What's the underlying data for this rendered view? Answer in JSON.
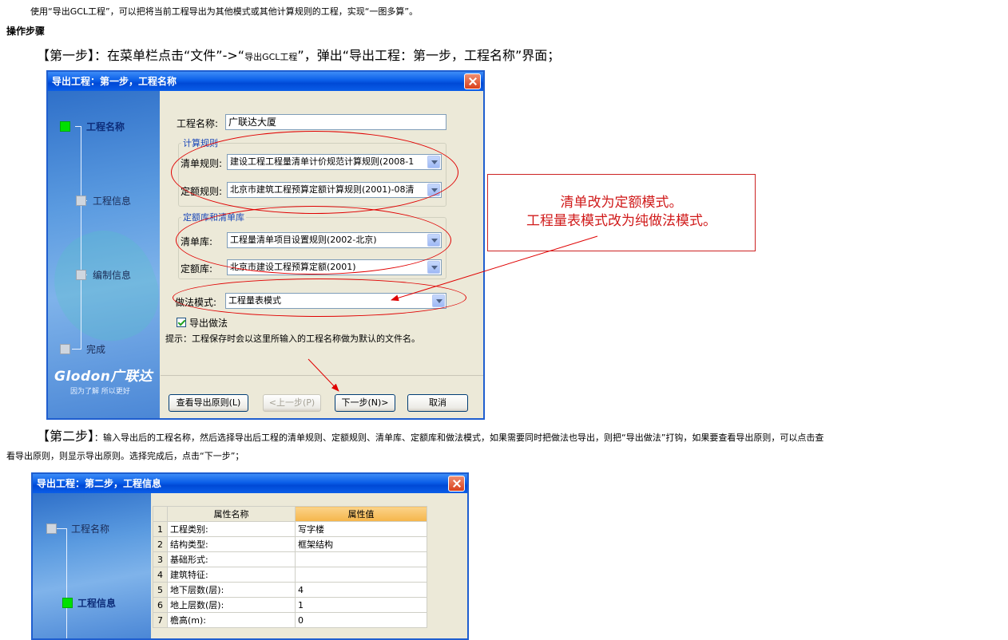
{
  "intro_text": "使用“导出GCL工程”，可以把将当前工程导出为其他模式或其他计算规则的工程，实现“一图多算”。",
  "steps_heading": "操作步骤",
  "step1": {
    "bracket": "【第一步】",
    "text": "：在菜单栏点击“文件”->“",
    "menu": "导出GCL工程",
    "text2": "”，弹出“导出工程：第一步，工程名称”界面；"
  },
  "dialog1": {
    "title": "导出工程：第一步，工程名称",
    "tree": [
      "工程名称",
      "工程信息",
      "编制信息",
      "完成"
    ],
    "logo": "Glodon广联达",
    "logo_sub": "因为了解 所以更好",
    "name_label": "工程名称:",
    "name_value": "广联达大厦",
    "group1_title": "计算规则",
    "qd_rule_label": "清单规则:",
    "qd_rule_value": "建设工程工程量清单计价规范计算规则(2008-1",
    "de_rule_label": "定额规则:",
    "de_rule_value": "北京市建筑工程预算定额计算规则(2001)-08清",
    "group2_title": "定额库和清单库",
    "qd_lib_label": "清单库:",
    "qd_lib_value": "工程量清单项目设置规则(2002-北京)",
    "de_lib_label": "定额库:",
    "de_lib_value": "北京市建设工程预算定额(2001)",
    "mode_label": "做法模式:",
    "mode_value": "工程量表模式",
    "export_check": "导出做法",
    "hint": "提示：工程保存时会以这里所输入的工程名称做为默认的文件名。",
    "buttons": {
      "view": "查看导出原则(L)",
      "prev": "<上一步(P)",
      "next": "下一步(N)>",
      "cancel": "取消"
    }
  },
  "callout": {
    "line1": "清单改为定额模式。",
    "line2": "工程量表模式改为纯做法模式。"
  },
  "step2": {
    "bracket": "【第二步】",
    "text": "：输入导出后的工程名称，然后选择导出后工程的清单规则、定额规则、清单库、定额库和做法模式，如果需要同时把做法也导出，则把“导出做法”打钩，如果要查看导出原则，可以点击查",
    "text_cont": "看导出原则，则显示导出原则。选择完成后，点击“下一步”；"
  },
  "dialog2": {
    "title": "导出工程：第二步，工程信息",
    "tree": [
      "工程名称",
      "工程信息"
    ],
    "col_name": "属性名称",
    "col_value": "属性值",
    "rows": [
      {
        "no": "1",
        "name": "工程类别:",
        "value": "写字楼"
      },
      {
        "no": "2",
        "name": "结构类型:",
        "value": "框架结构"
      },
      {
        "no": "3",
        "name": "基础形式:",
        "value": ""
      },
      {
        "no": "4",
        "name": "建筑特征:",
        "value": ""
      },
      {
        "no": "5",
        "name": "地下层数(层):",
        "value": "4"
      },
      {
        "no": "6",
        "name": "地上层数(层):",
        "value": "1"
      },
      {
        "no": "7",
        "name": "檐高(m):",
        "value": "0"
      }
    ]
  },
  "colors": {
    "title_blue": "#0a5ee8",
    "annotation_red": "#e00000",
    "active_node": "#00e000"
  }
}
